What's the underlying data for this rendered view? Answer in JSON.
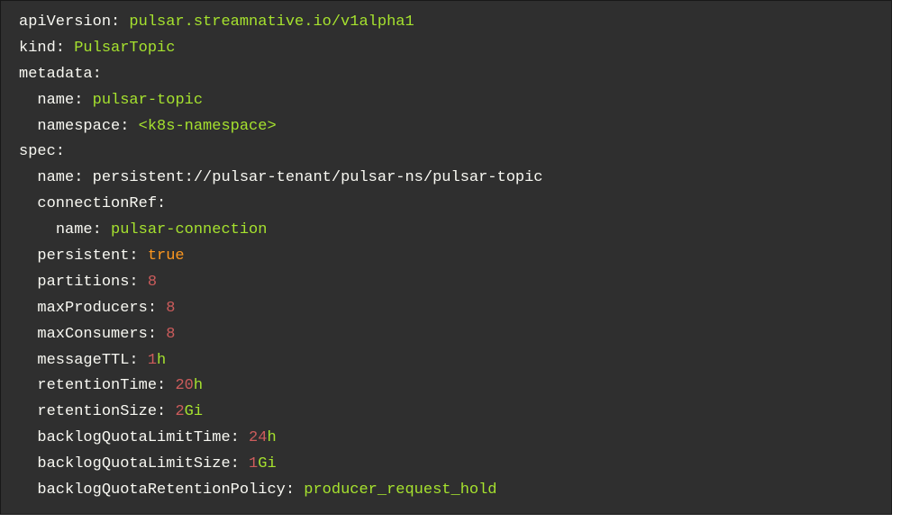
{
  "yaml": {
    "apiVersion_key": "apiVersion:",
    "apiVersion_val": "pulsar.streamnative.io/v1alpha1",
    "kind_key": "kind:",
    "kind_val": "PulsarTopic",
    "metadata_key": "metadata:",
    "metadata_name_key": "name:",
    "metadata_name_val": "pulsar-topic",
    "metadata_namespace_key": "namespace:",
    "metadata_namespace_val": "<k8s-namespace>",
    "spec_key": "spec:",
    "spec_name_key": "name:",
    "spec_name_val": "persistent://pulsar-tenant/pulsar-ns/pulsar-topic",
    "connectionRef_key": "connectionRef:",
    "connectionRef_name_key": "name:",
    "connectionRef_name_val": "pulsar-connection",
    "persistent_key": "persistent:",
    "persistent_val": "true",
    "partitions_key": "partitions:",
    "partitions_val": "8",
    "maxProducers_key": "maxProducers:",
    "maxProducers_val": "8",
    "maxConsumers_key": "maxConsumers:",
    "maxConsumers_val": "8",
    "messageTTL_key": "messageTTL:",
    "messageTTL_num": "1",
    "messageTTL_unit": "h",
    "retentionTime_key": "retentionTime:",
    "retentionTime_num": "20",
    "retentionTime_unit": "h",
    "retentionSize_key": "retentionSize:",
    "retentionSize_num": "2",
    "retentionSize_unit": "Gi",
    "backlogQuotaLimitTime_key": "backlogQuotaLimitTime:",
    "backlogQuotaLimitTime_num": "24",
    "backlogQuotaLimitTime_unit": "h",
    "backlogQuotaLimitSize_key": "backlogQuotaLimitSize:",
    "backlogQuotaLimitSize_num": "1",
    "backlogQuotaLimitSize_unit": "Gi",
    "backlogQuotaRetentionPolicy_key": "backlogQuotaRetentionPolicy:",
    "backlogQuotaRetentionPolicy_val": "producer_request_hold"
  }
}
